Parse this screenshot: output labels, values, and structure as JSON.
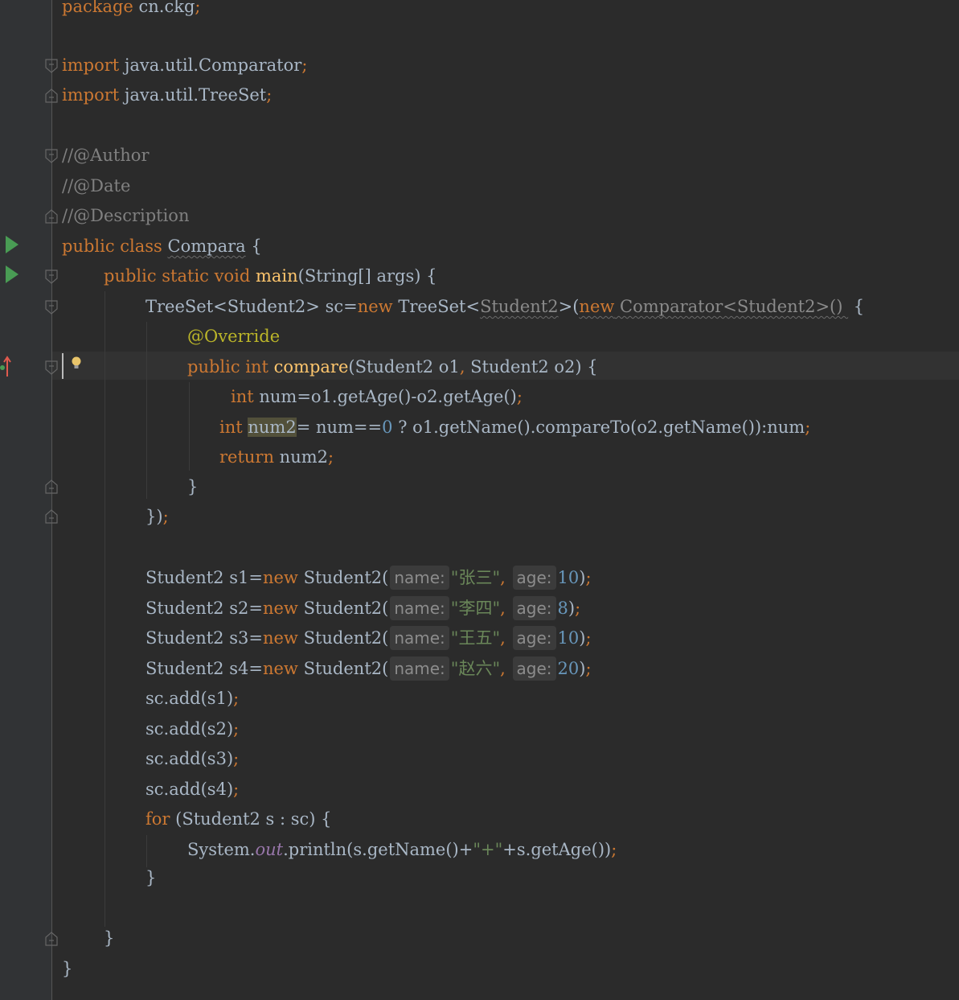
{
  "lines": {
    "l1": "package cn.ckg;",
    "l2": "import java.util.Comparator;",
    "l3": "import java.util.TreeSet;",
    "l4": "//@Author",
    "l5": "//@Date",
    "l6": "//@Description",
    "l7": "public class Compara {",
    "l8": "public static void main(String[] args) {",
    "l9": "TreeSet<Student2> sc=new TreeSet<Student2>(new Comparator<Student2>() {",
    "l10": "@Override",
    "l11": "public int compare(Student2 o1, Student2 o2) {",
    "l12": "int num=o1.getAge()-o2.getAge();",
    "l13": "int num2= num==0 ? o1.getName().compareTo(o2.getName()):num;",
    "l14": "return num2;",
    "l15": "}",
    "l16": "});",
    "l17": "Student2 s1=new Student2( name: \"张三\", age: 10);",
    "l18": "Student2 s2=new Student2( name: \"李四\", age: 8);",
    "l19": "Student2 s3=new Student2( name: \"王五\", age: 10);",
    "l20": "Student2 s4=new Student2( name: \"赵六\", age: 20);",
    "l21": "sc.add(s1);",
    "l22": "sc.add(s2);",
    "l23": "sc.add(s3);",
    "l24": "sc.add(s4);",
    "l25": "for (Student2 s : sc) {",
    "l26": "System.out.println(s.getName()+\"+\"+s.getAge());",
    "l27": "}",
    "l28": "}",
    "l29": "}"
  },
  "tokens": {
    "package": "package",
    "pkg_name": " cn.ckg",
    "semi": ";",
    "import": "import",
    "imp1": " java.util.Comparator",
    "imp2": " java.util.TreeSet",
    "author": "//@Author",
    "date": "//@Date",
    "description": "//@Description",
    "public": "public",
    "class": " class ",
    "class_name": "Compara",
    "brace_open": " {",
    "static_void": " static void ",
    "main": "main",
    "main_params": "(String[] args) {",
    "treeset_decl": "TreeSet<Student2> sc=",
    "new": "new",
    "treeset_ctor": " TreeSet<",
    "student2_type": "Student2",
    "gt_paren": ">(",
    "new_sq": "new",
    "comparator_sq": " Comparator<Student2>() ",
    "override": "@Override",
    "int": " int ",
    "compare": "compare",
    "compare_params": "(Student2 o1",
    "comma": ",",
    "compare_params2": " Student2 o2) {",
    "int_kw": "int",
    "num_expr": " num=o1.getAge()-o2.getAge()",
    "num2_var": "num2",
    "num2_expr": "= num==",
    "zero": "0",
    "num2_tail": " ? o1.getName().compareTo(o2.getName()):num",
    "return": "return",
    "return_expr": " num2",
    "close_brace": "}",
    "close_anon": "})",
    "s1_decl": "Student2 s1=",
    "s2_decl": "Student2 s2=",
    "s3_decl": "Student2 s3=",
    "s4_decl": "Student2 s4=",
    "student2_ctor": " Student2(",
    "hint_name": "name:",
    "hint_age": "age:",
    "name1": "\"张三\"",
    "name2": "\"李四\"",
    "name3": "\"王五\"",
    "name4": "\"赵六\"",
    "age1": "10",
    "age2": "8",
    "age3": "10",
    "age4": "20",
    "paren_close": ")",
    "add1": "sc.add(s1)",
    "add2": "sc.add(s2)",
    "add3": "sc.add(s3)",
    "add4": "sc.add(s4)",
    "for": "for",
    "for_expr": " (Student2 s : sc) {",
    "system": "System.",
    "out": "out",
    "println": ".println(s.getName()+",
    "plus_str": "\"+\"",
    "println_tail": "+s.getAge())"
  },
  "colors": {
    "background": "#2b2b2b",
    "gutter": "#313335",
    "keyword": "#cc7832",
    "comment": "#808080",
    "method": "#ffc66d",
    "annotation": "#bbb529",
    "number": "#6897bb",
    "string": "#6a8759",
    "field": "#9876aa",
    "text": "#a9b7c6",
    "run_icon": "#499c54"
  },
  "icons": [
    "run-icon",
    "fold-icon",
    "bulb-icon",
    "override-icon"
  ]
}
